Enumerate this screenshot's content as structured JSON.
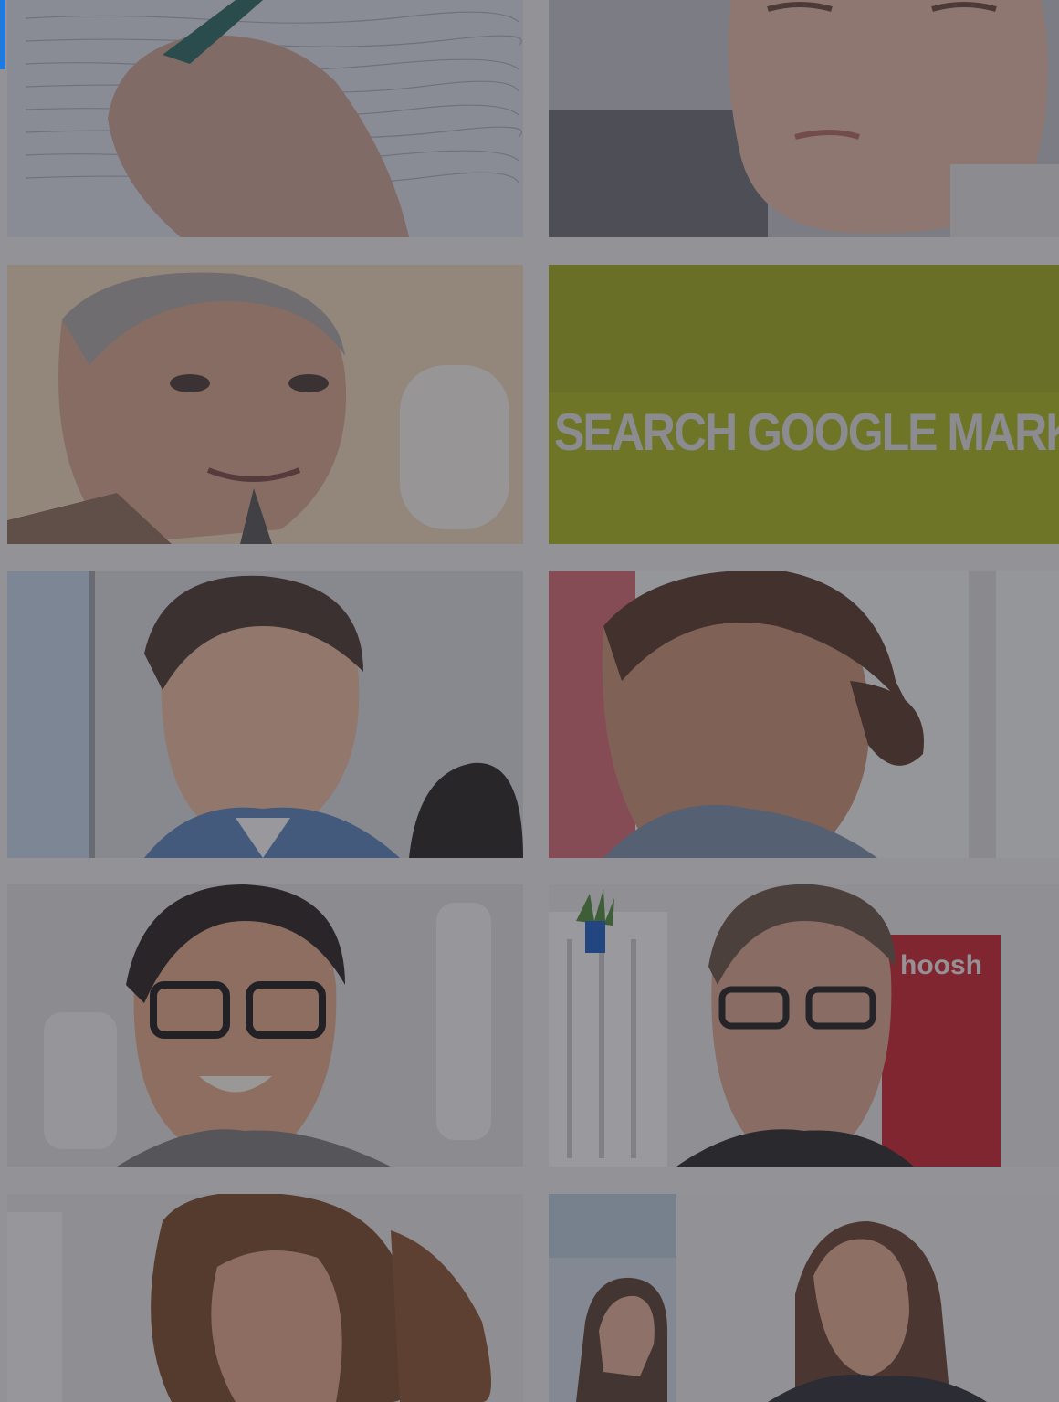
{
  "overlay": {
    "color": "#28283273"
  },
  "accent_color": "#1f7ae0",
  "tiles": [
    {
      "subject": "hand writing notes"
    },
    {
      "subject": "man close-up"
    },
    {
      "subject": "man with goatee"
    },
    {
      "subject": "banner",
      "text": "SEARCH GOOGLE MARKETING",
      "color": "#a8b51e"
    },
    {
      "subject": "young man"
    },
    {
      "subject": "woman"
    },
    {
      "subject": "smiling man with glasses"
    },
    {
      "subject": "man with glasses",
      "poster_text": "hoosh"
    },
    {
      "subject": "curly-haired woman"
    },
    {
      "subject": "two women"
    }
  ]
}
